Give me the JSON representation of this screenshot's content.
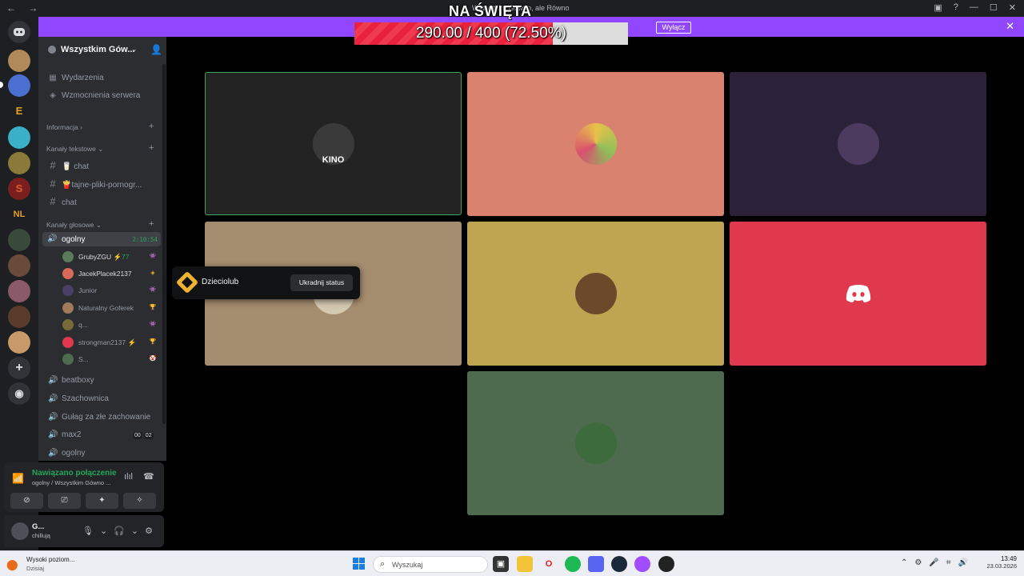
{
  "window": {
    "title": "Wszystkim Gówno, ale Równo",
    "nav_back": "←",
    "nav_forward": "→",
    "inbox_icon": "inbox-icon",
    "help": "?",
    "minimize": "—",
    "maximize": "☐",
    "close": "✕"
  },
  "banner": {
    "button_label": "Wyłącz",
    "close": "✕",
    "color": "#9147ff"
  },
  "goal_overlay": {
    "title": "NA ŚWIĘTA",
    "current": 290.0,
    "target": 400,
    "percent": 72.5,
    "text": "290.00 / 400 (72.50%)"
  },
  "server_rail": {
    "icons": [
      "discord-home-icon",
      "server-icon",
      "server-icon",
      "server-icon",
      "server-icon",
      "server-icon",
      "server-icon",
      "server-icon",
      "server-icon",
      "server-icon",
      "server-icon",
      "server-icon",
      "server-icon",
      "add-server-icon",
      "discover-icon"
    ],
    "glyph_e": "E",
    "glyph_s": "S",
    "glyph_nl": "NL",
    "add": "+"
  },
  "sidebar": {
    "server_name": "Wszystkim Gów...",
    "chevron": "⌄",
    "invite_icon": "👤",
    "top_items": [
      {
        "label": "Wydarzenia",
        "icon": "▦"
      },
      {
        "label": "Wzmocnienia serwera",
        "icon": "◈"
      }
    ],
    "categories": {
      "info": "Informacja",
      "text": "Kanały tekstowe",
      "voice": "Kanały głosowe",
      "plus": "+",
      "arrow_right": "›",
      "arrow_down": "⌄"
    },
    "text_channels": [
      {
        "label": "🥛 chat"
      },
      {
        "label": "🍟tajne-pliki-pornogr..."
      },
      {
        "label": "chat"
      }
    ],
    "hash": "#",
    "active_voice": {
      "label": "ogolny",
      "timer": "2:10:54",
      "icon": "🔊"
    },
    "voice_users": [
      {
        "name": "GrubyZGU",
        "extra": "⚡77",
        "badge": "👾",
        "color": "#5a7a5a"
      },
      {
        "name": "JacekPlacek2137",
        "extra": "",
        "badge": "◈",
        "color": "#d96a5a"
      },
      {
        "name": "Junior",
        "extra": "",
        "badge": "👾",
        "color": "#4a3f66"
      },
      {
        "name": "Naturalny Goferek",
        "extra": "",
        "badge": "🏆",
        "color": "#a07a5a"
      },
      {
        "name": "q...",
        "extra": "",
        "badge": "👾",
        "color": "#7a6a3a"
      },
      {
        "name": "strongman2137",
        "extra": "⚡",
        "badge": "🏆",
        "color": "#e0394e"
      },
      {
        "name": "S...",
        "extra": "",
        "badge": "🤡",
        "color": "#4f6b4f"
      }
    ],
    "other_voice": [
      {
        "label": "beatboxy"
      },
      {
        "label": "Szachownica"
      },
      {
        "label": "Gułag za złe zachowanie"
      },
      {
        "label": "max2",
        "tag1": "00",
        "tag2": "02"
      },
      {
        "label": "ogolny"
      }
    ],
    "speaker_icon": "🔊"
  },
  "tooltip": {
    "label": "Dzieciolub",
    "button": "Ukradnij status"
  },
  "connection": {
    "title": "Nawiązano połączenie",
    "subtitle": "ogolny / Wszystkim Gówno ...",
    "wave_icon": "ılıl",
    "hangup_icon": "☎",
    "signal_icon": "📶",
    "buttons": [
      "⊘",
      "⎚",
      "✦",
      "✧"
    ]
  },
  "user_panel": {
    "name": "G...",
    "status": "chillują",
    "mic": "🎙",
    "chev": "⌄",
    "headset": "🎧",
    "settings": "⚙"
  },
  "video_tiles": [
    {
      "bg": "#232323",
      "avatar": "#3a3a3a",
      "label": "KINO",
      "border": "#3ba55c"
    },
    {
      "bg": "#d9826f",
      "avatar": "#e8c24a",
      "label": ""
    },
    {
      "bg": "#2b2239",
      "avatar": "#4c3b5e",
      "label": ""
    },
    {
      "bg": "#a48c6e",
      "avatar": "#d3c8b0",
      "label": ""
    },
    {
      "bg": "#bfa552",
      "avatar": "#6a4a2a",
      "label": ""
    },
    {
      "bg": "#e0394e",
      "avatar": "",
      "label": ""
    },
    {
      "bg": "#4f6b4f",
      "avatar": "#3d6b3d",
      "label": ""
    }
  ],
  "taskbar": {
    "weather_title": "Wysoki poziom...",
    "weather_sub": "Dzisiaj",
    "search_placeholder": "Wyszukaj",
    "time": "13:49",
    "date": "23.03.2026",
    "apps": [
      "file-explorer-icon",
      "folder-icon",
      "opera-icon",
      "spotify-icon",
      "discord-icon",
      "steam-icon",
      "messenger-icon",
      "obs-icon"
    ],
    "tray": [
      "⌃",
      "⚙",
      "🎤",
      "⌗",
      "🔊"
    ]
  }
}
